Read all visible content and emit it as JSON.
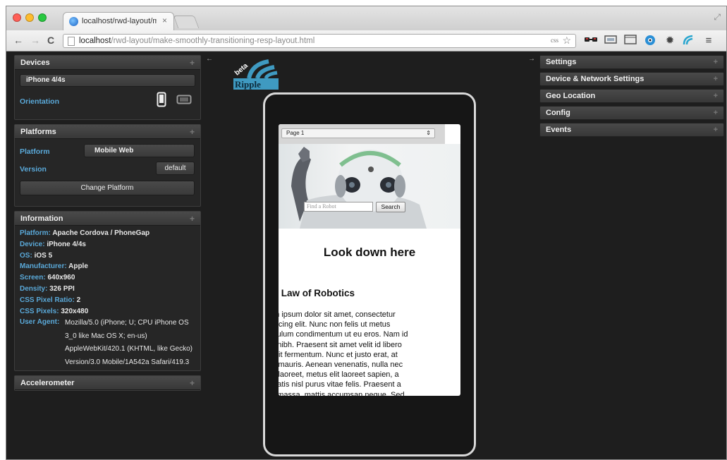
{
  "browser": {
    "tab_title": "localhost/rwd-layout/make-",
    "tab_close": "×",
    "url_host": "localhost",
    "url_path": "/rwd-layout/make-smoothly-transitioning-resp-layout.html",
    "nav": {
      "back": "←",
      "forward": "→",
      "reload": "C"
    },
    "css_badge": "css",
    "star": "☆",
    "resize": "⤢"
  },
  "colors": {
    "accent": "#5aa9d9",
    "panel_bg": "#262626",
    "app_bg": "#1e1e1e"
  },
  "left_panels": {
    "devices": {
      "title": "Devices",
      "device": "iPhone 4/4s",
      "orientation_label": "Orientation"
    },
    "platforms": {
      "title": "Platforms",
      "platform_label": "Platform",
      "platform_value": "Mobile Web",
      "version_label": "Version",
      "version_value": "default",
      "change_button": "Change Platform"
    },
    "information": {
      "title": "Information",
      "rows": [
        {
          "k": "Platform:",
          "v": "Apache Cordova / PhoneGap"
        },
        {
          "k": "Device:",
          "v": "iPhone 4/4s"
        },
        {
          "k": "OS:",
          "v": "iOS 5"
        },
        {
          "k": "Manufacturer:",
          "v": "Apple"
        },
        {
          "k": "Screen:",
          "v": "640x960"
        },
        {
          "k": "Density:",
          "v": "326 PPI"
        },
        {
          "k": "CSS Pixel Ratio:",
          "v": "2"
        },
        {
          "k": "CSS Pixels:",
          "v": "320x480"
        }
      ],
      "ua_label": "User Agent:",
      "ua_lines": [
        "Mozilla/5.0 (iPhone; U; CPU iPhone OS",
        "3_0 like Mac OS X; en-us)",
        "AppleWebKit/420.1 (KHTML, like Gecko)",
        "Version/3.0 Mobile/1A542a Safari/419.3"
      ]
    },
    "accelerometer": {
      "title": "Accelerometer"
    },
    "plus": "+"
  },
  "collapse_left": "←",
  "collapse_right": "→",
  "logo": {
    "badge": "beta",
    "name": "Ripple"
  },
  "right_panels": [
    {
      "title": "Settings"
    },
    {
      "title": "Device & Network Settings"
    },
    {
      "title": "Geo Location"
    },
    {
      "title": "Config"
    },
    {
      "title": "Events"
    }
  ],
  "screen": {
    "select_value": "Page 1",
    "select_arrow": "⇕",
    "search_placeholder": "Find a Robot",
    "search_button": "Search",
    "heading": "Look down here",
    "subheading": "st Law of Robotics",
    "paragraph_lines": [
      "em ipsum dolor sit amet, consectetur",
      "piscing elit. Nunc non felis ut metus",
      "tibulum condimentum ut eu eros. Nam id",
      "m nibh. Praesent sit amet velit id libero",
      "cipit fermentum. Nunc et justo erat, at",
      "lis mauris. Aenean venenatis, nulla nec",
      "lis laoreet, metus elit laoreet sapien, a",
      "enatis nisl purus vitae felis. Praesent a",
      "m massa, mattis accumsan neque. Sed"
    ]
  }
}
